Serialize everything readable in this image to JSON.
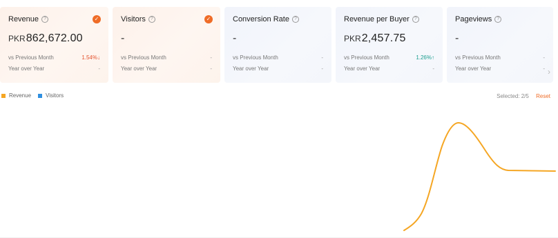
{
  "cards": [
    {
      "title": "Revenue",
      "selected": true,
      "currency": "PKR",
      "value": "862,672.00",
      "prev_label": "vs Previous Month",
      "prev_value": "1.54%↓",
      "prev_trend": "down",
      "yoy_label": "Year over Year",
      "yoy_value": "-"
    },
    {
      "title": "Visitors",
      "selected": true,
      "currency": "",
      "value": "-",
      "prev_label": "vs Previous Month",
      "prev_value": "-",
      "prev_trend": "neutral",
      "yoy_label": "Year over Year",
      "yoy_value": "-"
    },
    {
      "title": "Conversion Rate",
      "selected": false,
      "currency": "",
      "value": "-",
      "prev_label": "vs Previous Month",
      "prev_value": "-",
      "prev_trend": "neutral",
      "yoy_label": "Year over Year",
      "yoy_value": "-"
    },
    {
      "title": "Revenue per Buyer",
      "selected": false,
      "currency": "PKR",
      "value": "2,457.75",
      "prev_label": "vs Previous Month",
      "prev_value": "1.26%↑",
      "prev_trend": "up",
      "yoy_label": "Year over Year",
      "yoy_value": "-"
    },
    {
      "title": "Pageviews",
      "selected": false,
      "currency": "",
      "value": "-",
      "prev_label": "vs Previous Month",
      "prev_value": "-",
      "prev_trend": "neutral",
      "yoy_label": "Year over Year",
      "yoy_value": "-"
    }
  ],
  "legend": [
    {
      "label": "Revenue",
      "color": "#f5a623"
    },
    {
      "label": "Visitors",
      "color": "#2f8fe0"
    }
  ],
  "selection": {
    "label": "Selected:",
    "count": "2/5",
    "reset_label": "Reset"
  },
  "colors": {
    "accent": "#ef6c27",
    "revenue_line": "#f5a623"
  },
  "icons": {
    "help": "question-circle-icon",
    "check": "check-circle-icon",
    "scroll": "chevron-right-icon"
  }
}
